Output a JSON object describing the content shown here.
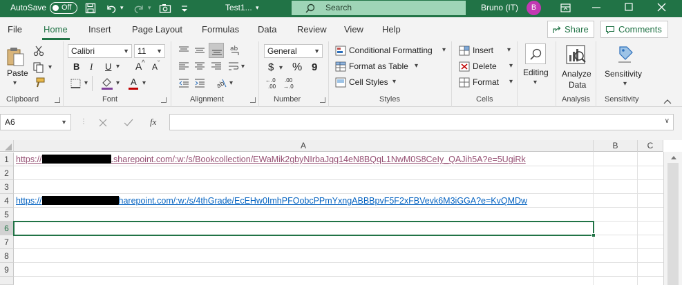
{
  "titlebar": {
    "autosave_label": "AutoSave",
    "autosave_state": "Off",
    "filename": "Test1...",
    "search_placeholder": "Search",
    "user_name": "Bruno (IT)",
    "user_initial": "B"
  },
  "menu": {
    "tabs": [
      "File",
      "Home",
      "Insert",
      "Page Layout",
      "Formulas",
      "Data",
      "Review",
      "View",
      "Help"
    ],
    "active_tab": "Home",
    "share_label": "Share",
    "comments_label": "Comments"
  },
  "ribbon": {
    "clipboard": {
      "label": "Clipboard",
      "paste_label": "Paste"
    },
    "font": {
      "label": "Font",
      "name": "Calibri",
      "size": "11",
      "grow": "A",
      "shrink": "A",
      "bold": "B",
      "italic": "I",
      "underline": "U",
      "color_a": "A"
    },
    "alignment": {
      "label": "Alignment"
    },
    "number": {
      "label": "Number",
      "format": "General",
      "currency": "$",
      "percent": "%",
      "comma": "9",
      "inc_decimal": "←.0",
      "inc_decimal_sub": ".00",
      "dec_decimal": ".00",
      "dec_decimal_sub": "→.0"
    },
    "styles": {
      "label": "Styles",
      "conditional": "Conditional Formatting",
      "format_table": "Format as Table",
      "cell_styles": "Cell Styles"
    },
    "cells": {
      "label": "Cells",
      "insert": "Insert",
      "delete": "Delete",
      "format": "Format"
    },
    "editing": {
      "label": "Editing"
    },
    "analysis": {
      "label": "Analysis",
      "analyze_line1": "Analyze",
      "analyze_line2": "Data"
    },
    "sensitivity": {
      "label": "Sensitivity",
      "button": "Sensitivity"
    }
  },
  "formula_bar": {
    "name_box": "A6",
    "fx": "fx",
    "formula": ""
  },
  "grid": {
    "columns": [
      "A",
      "B",
      "C"
    ],
    "rows": [
      "1",
      "2",
      "3",
      "4",
      "5",
      "6",
      "7",
      "8",
      "9"
    ],
    "active_row": "6",
    "cells": {
      "A1_prefix": "https://",
      "A1_suffix": ".sharepoint.com/:w:/s/Bookcollection/EWaMik2gbyNIrbaJqq14eN8BQqL1NwM0S8CeIy_QAJih5A?e=5UgiRk",
      "A4_prefix": "https://",
      "A4_suffix": "harepoint.com/:w:/s/4thGrade/EcEHw0ImhPFOobcPPmYxngABBBpvF5F2xFBVevk6M3iGGA?e=KvQMDw"
    }
  },
  "colors": {
    "accent": "#217346",
    "link_visited": "#954F72",
    "link": "#0563C1"
  }
}
